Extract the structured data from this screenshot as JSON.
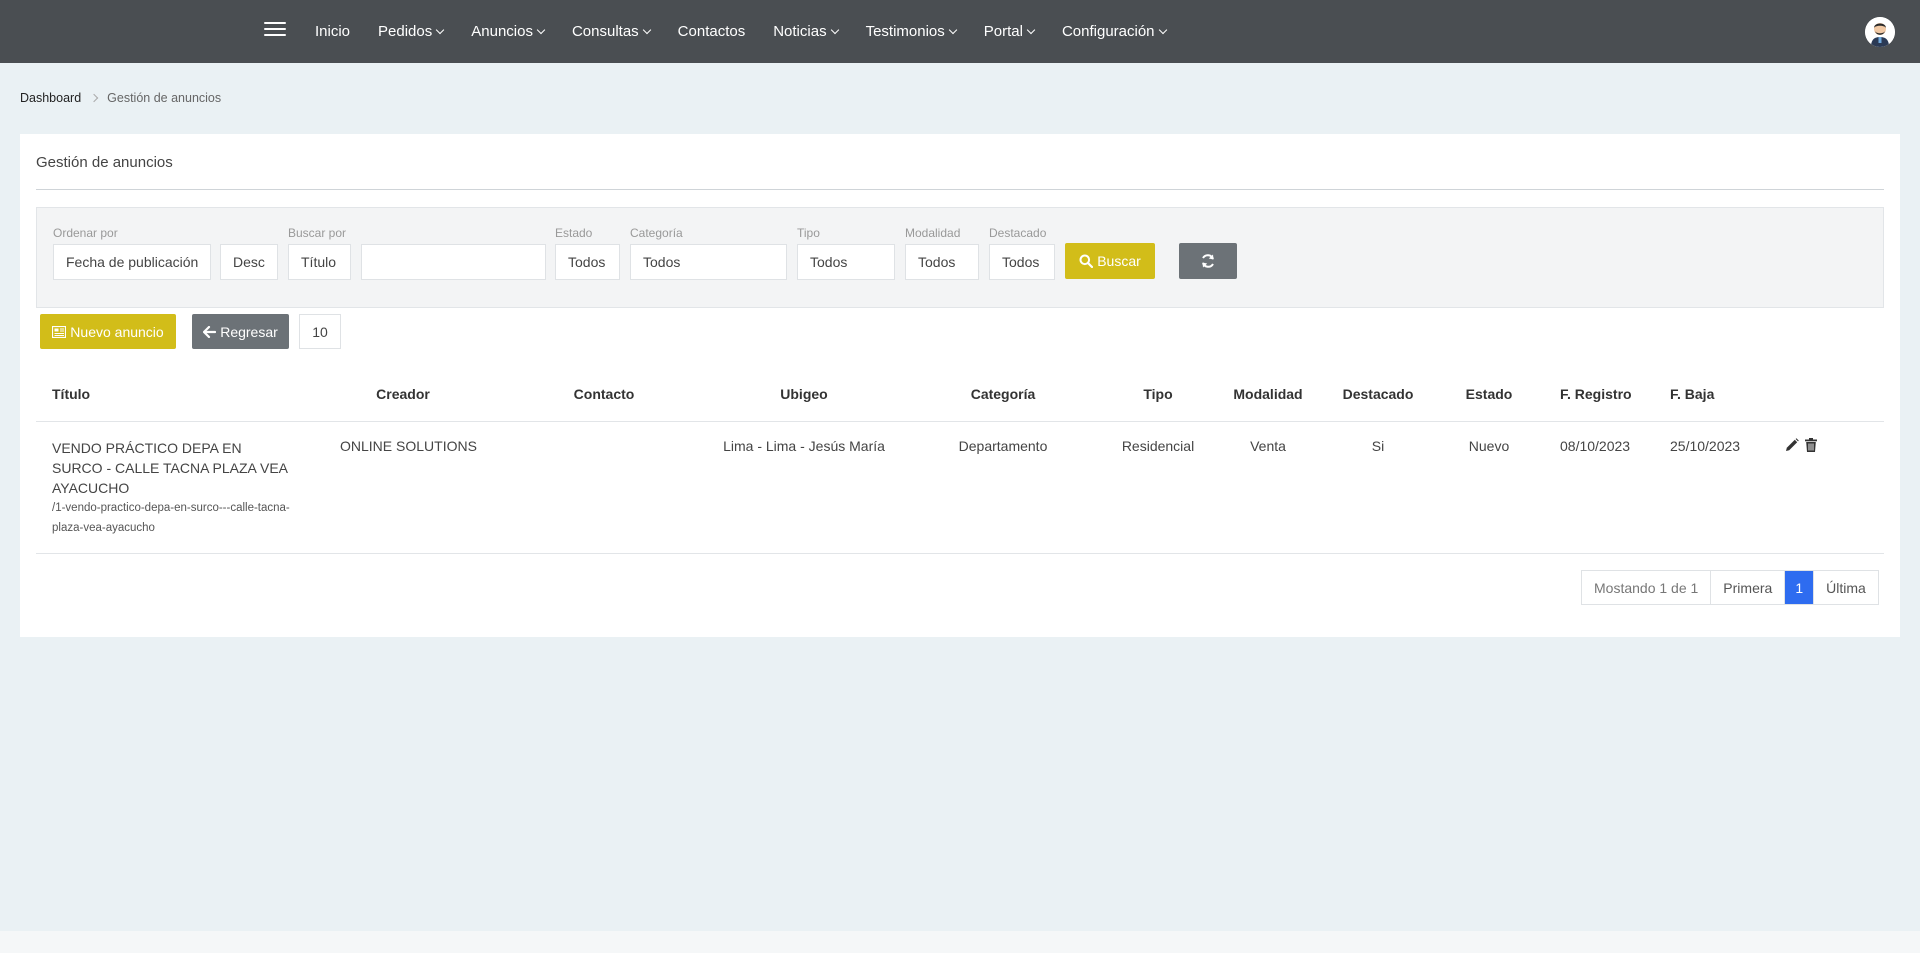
{
  "nav": {
    "items": [
      {
        "label": "Inicio",
        "dropdown": false
      },
      {
        "label": "Pedidos",
        "dropdown": true
      },
      {
        "label": "Anuncios",
        "dropdown": true
      },
      {
        "label": "Consultas",
        "dropdown": true
      },
      {
        "label": "Contactos",
        "dropdown": false
      },
      {
        "label": "Noticias",
        "dropdown": true
      },
      {
        "label": "Testimonios",
        "dropdown": true
      },
      {
        "label": "Portal",
        "dropdown": true
      },
      {
        "label": "Configuración",
        "dropdown": true
      }
    ],
    "menu_icon": "hamburger-menu-icon",
    "avatar_icon": "user-avatar-icon"
  },
  "breadcrumb": {
    "home": "Dashboard",
    "current": "Gestión de anuncios"
  },
  "card": {
    "title": "Gestión de anuncios"
  },
  "filters": {
    "ordenar_label": "Ordenar por",
    "ordenar_value": "Fecha de publicación",
    "orden_dir": "Desc",
    "buscar_label": "Buscar por",
    "buscar_field": "Título",
    "buscar_text": "",
    "estado_label": "Estado",
    "estado_value": "Todos",
    "categoria_label": "Categoría",
    "categoria_value": "Todos",
    "tipo_label": "Tipo",
    "tipo_value": "Todos",
    "modalidad_label": "Modalidad",
    "modalidad_value": "Todos",
    "destacado_label": "Destacado",
    "destacado_value": "Todos",
    "buscar_button": "Buscar",
    "refresh_icon": "refresh-icon"
  },
  "actions": {
    "nuevo": "Nuevo anuncio",
    "regresar": "Regresar",
    "page_size": "10"
  },
  "table": {
    "headers": {
      "titulo": "Título",
      "creador": "Creador",
      "contacto": "Contacto",
      "ubigeo": "Ubigeo",
      "categoria": "Categoría",
      "tipo": "Tipo",
      "modalidad": "Modalidad",
      "destacado": "Destacado",
      "estado": "Estado",
      "f_registro": "F. Registro",
      "f_baja": "F. Baja"
    },
    "rows": [
      {
        "titulo": "VENDO PRÁCTICO DEPA EN SURCO - CALLE TACNA PLAZA VEA AYACUCHO",
        "slug": "/1-vendo-practico-depa-en-surco---calle-tacna-plaza-vea-ayacucho",
        "creador": "ONLINE SOLUTIONS",
        "contacto": "",
        "ubigeo": "Lima - Lima - Jesús María",
        "categoria": "Departamento",
        "tipo": "Residencial",
        "modalidad": "Venta",
        "destacado": "Si",
        "estado": "Nuevo",
        "f_registro": "08/10/2023",
        "f_baja": "25/10/2023"
      }
    ]
  },
  "pagination": {
    "info": "Mostando 1 de 1",
    "first": "Primera",
    "current": "1",
    "last": "Última"
  },
  "colors": {
    "topbar": "#4a4e52",
    "accent": "#d2bd19",
    "secondary": "#6c7277",
    "active_page": "#2e6cf0"
  }
}
